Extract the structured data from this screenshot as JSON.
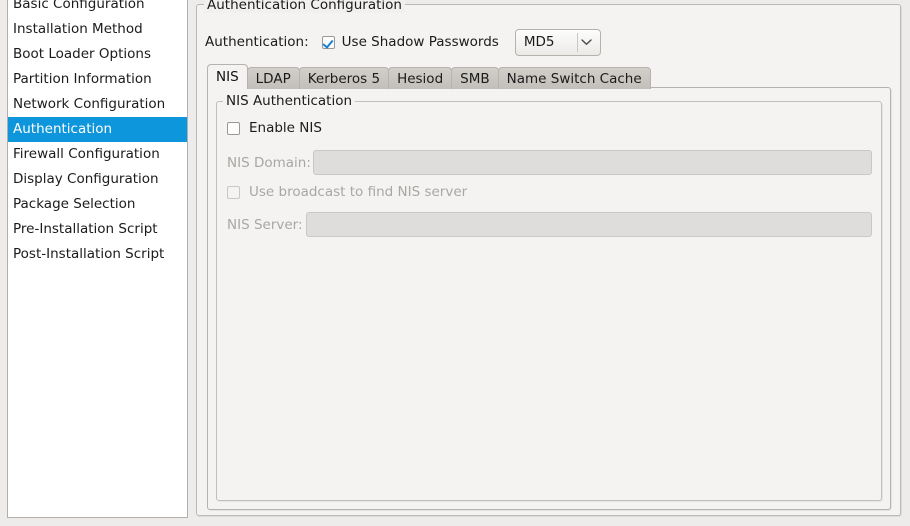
{
  "sidebar": {
    "items": [
      {
        "label": "Basic Configuration",
        "selected": false
      },
      {
        "label": "Installation Method",
        "selected": false
      },
      {
        "label": "Boot Loader Options",
        "selected": false
      },
      {
        "label": "Partition Information",
        "selected": false
      },
      {
        "label": "Network Configuration",
        "selected": false
      },
      {
        "label": "Authentication",
        "selected": true
      },
      {
        "label": "Firewall Configuration",
        "selected": false
      },
      {
        "label": "Display Configuration",
        "selected": false
      },
      {
        "label": "Package Selection",
        "selected": false
      },
      {
        "label": "Pre-Installation Script",
        "selected": false
      },
      {
        "label": "Post-Installation Script",
        "selected": false
      }
    ],
    "selection_color": "#0e96dd"
  },
  "auth_config": {
    "frame_title": "Authentication Configuration",
    "auth_label": "Authentication:",
    "shadow_passwords": {
      "label": "Use Shadow Passwords",
      "checked": true
    },
    "hash_combo": {
      "value": "MD5",
      "arrow": "ˇ"
    },
    "tabs": [
      {
        "label": "NIS",
        "active": true
      },
      {
        "label": "LDAP",
        "active": false
      },
      {
        "label": "Kerberos 5",
        "active": false
      },
      {
        "label": "Hesiod",
        "active": false
      },
      {
        "label": "SMB",
        "active": false
      },
      {
        "label": "Name Switch Cache",
        "active": false
      }
    ],
    "nis_panel": {
      "group_title": "NIS Authentication",
      "enable_nis": {
        "label": "Enable NIS",
        "checked": false
      },
      "domain_label": "NIS Domain:",
      "domain_value": "",
      "broadcast": {
        "label": "Use broadcast to find NIS server",
        "checked": false
      },
      "server_label": "NIS Server:",
      "server_value": ""
    }
  }
}
